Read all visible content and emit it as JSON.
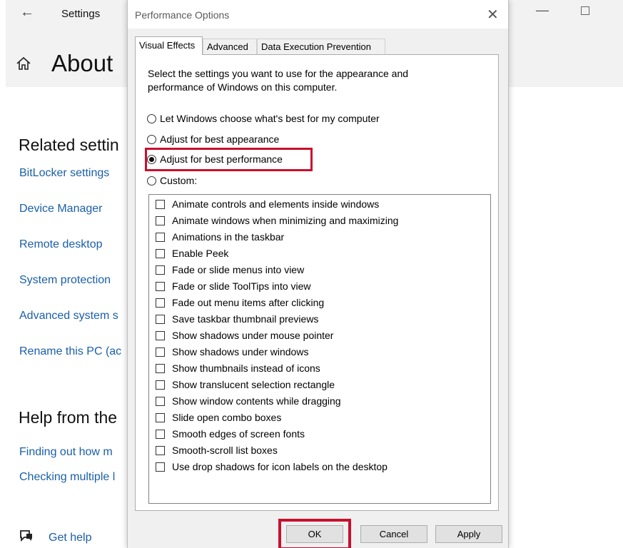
{
  "settings": {
    "window_title": "Settings",
    "page_title": "About",
    "related_title": "Related settin",
    "related_links": [
      "BitLocker settings",
      "Device Manager",
      "Remote desktop",
      "System protection",
      "Advanced system s",
      "Rename this PC (ac"
    ],
    "help_title": "Help from the",
    "help_links": [
      "Finding out how m",
      "Checking multiple l"
    ],
    "get_help": "Get help"
  },
  "dialog": {
    "title": "Performance Options",
    "tabs": [
      "Visual Effects",
      "Advanced",
      "Data Execution Prevention"
    ],
    "active_tab": "Visual Effects",
    "intro": "Select the settings you want to use for the appearance and performance of Windows on this computer.",
    "radio_options": [
      {
        "label": "Let Windows choose what's best for my computer",
        "checked": false
      },
      {
        "label": "Adjust for best appearance",
        "checked": false
      },
      {
        "label": "Adjust for best performance",
        "checked": true
      },
      {
        "label": "Custom:",
        "checked": false
      }
    ],
    "checkboxes": [
      "Animate controls and elements inside windows",
      "Animate windows when minimizing and maximizing",
      "Animations in the taskbar",
      "Enable Peek",
      "Fade or slide menus into view",
      "Fade or slide ToolTips into view",
      "Fade out menu items after clicking",
      "Save taskbar thumbnail previews",
      "Show shadows under mouse pointer",
      "Show shadows under windows",
      "Show thumbnails instead of icons",
      "Show translucent selection rectangle",
      "Show window contents while dragging",
      "Slide open combo boxes",
      "Smooth edges of screen fonts",
      "Smooth-scroll list boxes",
      "Use drop shadows for icon labels on the desktop"
    ],
    "buttons": {
      "ok": "OK",
      "cancel": "Cancel",
      "apply": "Apply"
    }
  },
  "colors": {
    "highlight": "#c8102e",
    "link": "#1a5fa8"
  },
  "icons": {
    "back": "back-arrow-icon",
    "home": "home-icon",
    "close": "close-icon",
    "help": "help-chat-icon"
  }
}
